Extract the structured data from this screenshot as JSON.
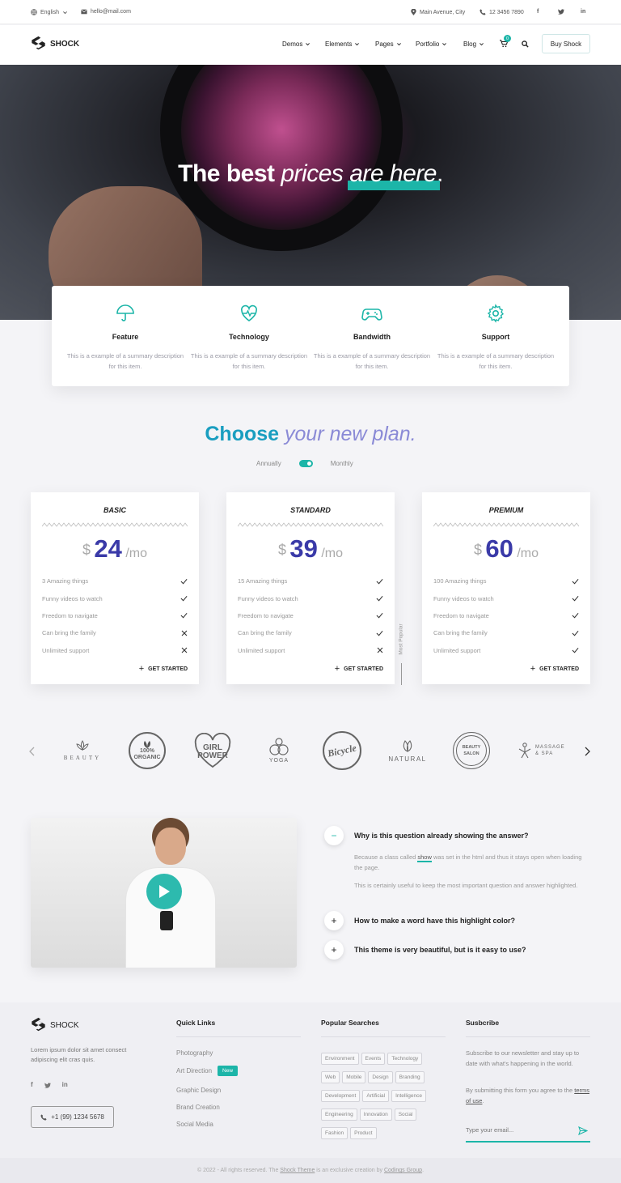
{
  "topbar": {
    "language": "English",
    "email": "hello@mail.com",
    "address": "Main Avenue, City",
    "phone": "12 3456 7890"
  },
  "brand": {
    "name": "SHOCK"
  },
  "nav": {
    "items": [
      {
        "label": "Demos"
      },
      {
        "label": "Elements"
      },
      {
        "label": "Pages"
      },
      {
        "label": "Portfolio"
      },
      {
        "label": "Blog"
      }
    ],
    "cart_count": "0",
    "cta": "Buy Shock"
  },
  "hero": {
    "bold": "The best",
    "italic": "prices",
    "highlight": "are here",
    "dot": "."
  },
  "features": [
    {
      "title": "Feature",
      "desc": "This is a example of a summary description for this item.",
      "icon": "umbrella-icon"
    },
    {
      "title": "Technology",
      "desc": "This is a example of a summary description for this item.",
      "icon": "heartbeat-icon"
    },
    {
      "title": "Bandwidth",
      "desc": "This is a example of a summary description for this item.",
      "icon": "gamepad-icon"
    },
    {
      "title": "Support",
      "desc": "This is a example of a summary description for this item.",
      "icon": "gear-icon"
    }
  ],
  "plans_section": {
    "title_bold": "Choose",
    "title_italic": "your new plan.",
    "toggle_left": "Annually",
    "toggle_right": "Monthly",
    "most_popular": "Most Popular"
  },
  "plans": [
    {
      "name": "BASIC",
      "currency": "$",
      "price": "24",
      "period": "/mo",
      "cta": "GET STARTED",
      "features": [
        {
          "label": "3 Amazing things",
          "ok": true
        },
        {
          "label": "Funny videos to watch",
          "ok": true
        },
        {
          "label": "Freedom to navigate",
          "ok": true
        },
        {
          "label": "Can bring the family",
          "ok": false
        },
        {
          "label": "Unlimited support",
          "ok": false
        }
      ]
    },
    {
      "name": "STANDARD",
      "currency": "$",
      "price": "39",
      "period": "/mo",
      "cta": "GET STARTED",
      "features": [
        {
          "label": "15 Amazing things",
          "ok": true
        },
        {
          "label": "Funny videos to watch",
          "ok": true
        },
        {
          "label": "Freedom to navigate",
          "ok": true
        },
        {
          "label": "Can bring the family",
          "ok": true
        },
        {
          "label": "Unlimited support",
          "ok": false
        }
      ]
    },
    {
      "name": "PREMIUM",
      "currency": "$",
      "price": "60",
      "period": "/mo",
      "cta": "GET STARTED",
      "features": [
        {
          "label": "100 Amazing things",
          "ok": true
        },
        {
          "label": "Funny videos to watch",
          "ok": true
        },
        {
          "label": "Freedom to navigate",
          "ok": true
        },
        {
          "label": "Can bring the family",
          "ok": true
        },
        {
          "label": "Unlimited support",
          "ok": true
        }
      ]
    }
  ],
  "brands": [
    "BEAUTY",
    "100% ORGANIC",
    "GIRL POWER",
    "YOGA",
    "Bicycle",
    "NATURAL",
    "BEAUTY SALON",
    "MASSAGE & SPA"
  ],
  "faq": {
    "q1": "Why is this question already showing the answer?",
    "a1_pre": "Because a class called ",
    "a1_mark": "show",
    "a1_post": " was set in the html and thus it stays open when loading the page.",
    "a2": "This is certainly useful to keep the most important question and answer highlighted.",
    "q2": "How to make a word have this highlight color?",
    "q3": "This theme is very beautiful, but is it easy to use?"
  },
  "footer": {
    "about": "Lorem ipsum dolor sit amet consect adipiscing elit cras quis.",
    "phone": "+1 (99) 1234 5678",
    "quick_title": "Quick Links",
    "quick": [
      "Photography",
      "Art Direction",
      "Graphic Design",
      "Brand Creation",
      "Social Media"
    ],
    "new_badge": "New",
    "popular_title": "Popular Searches",
    "tags": [
      "Environment",
      "Events",
      "Technology",
      "Web",
      "Mobile",
      "Design",
      "Branding",
      "Development",
      "Artificial",
      "Intelligence",
      "Engineering",
      "Innovation",
      "Social",
      "Fashion",
      "Product"
    ],
    "subscribe_title": "Susbcribe",
    "sub_text": "Subscribe to our newsletter and stay up to date with what's happening in the world.",
    "sub_agree_pre": "By submitting this form you agree to the ",
    "sub_agree_link": "terms of use",
    "sub_agree_post": ".",
    "email_placeholder": "Type your email..."
  },
  "copyright": {
    "pre": "© 2022 - All rights reserved. The ",
    "link1": "Shock Theme",
    "mid": " is an exclusive creation by ",
    "link2": "Codings Group",
    "post": "."
  },
  "colors": {
    "accent": "#1cb5a8",
    "primary": "#3a3aa8"
  }
}
